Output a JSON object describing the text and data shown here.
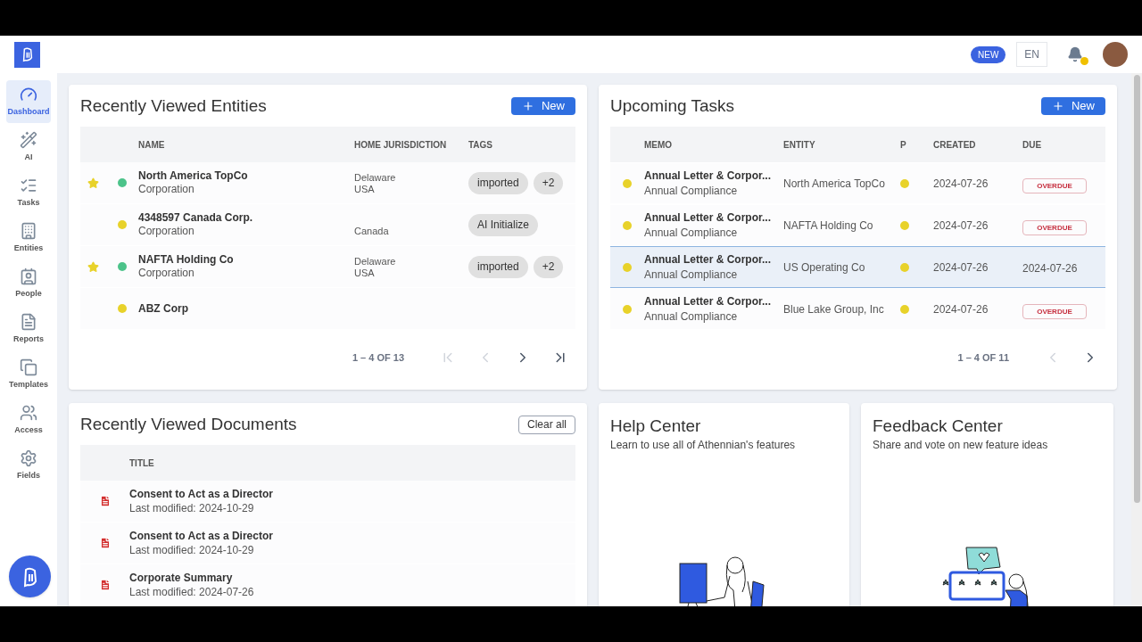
{
  "header": {
    "new_badge": "NEW",
    "language": "EN",
    "notification_dot": true
  },
  "sidebar": {
    "items": [
      {
        "label": "Dashboard",
        "kind": "dashboard",
        "selected": true
      },
      {
        "label": "AI",
        "kind": "ai",
        "selected": false
      },
      {
        "label": "Tasks",
        "kind": "tasks",
        "selected": false
      },
      {
        "label": "Entities",
        "kind": "entities",
        "selected": false
      },
      {
        "label": "People",
        "kind": "people",
        "selected": false
      },
      {
        "label": "Reports",
        "kind": "reports",
        "selected": false
      },
      {
        "label": "Templates",
        "kind": "templates",
        "selected": false
      },
      {
        "label": "Access",
        "kind": "access",
        "selected": false
      },
      {
        "label": "Fields",
        "kind": "fields",
        "selected": false
      }
    ]
  },
  "entities": {
    "title": "Recently Viewed Entities",
    "new_button": "New",
    "columns": [
      "NAME",
      "HOME JURISDICTION",
      "TAGS"
    ],
    "rows": [
      {
        "starred": true,
        "color": "#4cc38a",
        "name": "North America TopCo",
        "type": "Corporation",
        "jurisdiction": [
          "Delaware",
          "USA"
        ],
        "tags": [
          "imported",
          "+2"
        ]
      },
      {
        "starred": false,
        "color": "#e8d22a",
        "name": "4348597 Canada Corp.",
        "type": "Corporation",
        "jurisdiction": [
          "Canada"
        ],
        "tags": [
          "AI Initialize"
        ]
      },
      {
        "starred": true,
        "color": "#4cc38a",
        "name": "NAFTA Holding Co",
        "type": "Corporation",
        "jurisdiction": [
          "Delaware",
          "USA"
        ],
        "tags": [
          "imported",
          "+2"
        ]
      },
      {
        "starred": false,
        "color": "#e8d22a",
        "name": "ABZ Corp",
        "jurisdiction": [],
        "tags": []
      }
    ],
    "pagination": {
      "range": "1 – 4 OF 13",
      "buttons": [
        {
          "kind": "first",
          "disabled": true
        },
        {
          "kind": "prev",
          "disabled": true
        },
        {
          "kind": "next",
          "disabled": false
        },
        {
          "kind": "last",
          "disabled": false
        }
      ]
    }
  },
  "tasks": {
    "title": "Upcoming Tasks",
    "new_button": "New",
    "columns": [
      "MEMO",
      "ENTITY",
      "P",
      "CREATED",
      "DUE"
    ],
    "rows": [
      {
        "selected": false,
        "color": "#e8d22a",
        "memo": "Annual Letter & Corpor...",
        "category": "Annual Compliance",
        "entity": "North America TopCo",
        "priority": {
          "color": "#e8d22a"
        },
        "created": "2024-07-26",
        "due": {
          "kind": "badge",
          "text": "OVERDUE"
        }
      },
      {
        "selected": false,
        "color": "#e8d22a",
        "memo": "Annual Letter & Corpor...",
        "category": "Annual Compliance",
        "entity": "NAFTA Holding Co",
        "priority": {
          "color": "#e8d22a"
        },
        "created": "2024-07-26",
        "due": {
          "kind": "badge",
          "text": "OVERDUE"
        }
      },
      {
        "selected": true,
        "color": "#e8d22a",
        "memo": "Annual Letter & Corpor...",
        "category": "Annual Compliance",
        "entity": "US Operating Co",
        "priority": {
          "color": "#e8d22a"
        },
        "created": "2024-07-26",
        "due": {
          "kind": "date",
          "text": "2024-07-26"
        }
      },
      {
        "selected": false,
        "color": "#e8d22a",
        "memo": "Annual Letter & Corpor...",
        "category": "Annual Compliance",
        "entity": "Blue Lake Group, Inc",
        "priority": {
          "color": "#e8d22a"
        },
        "created": "2024-07-26",
        "due": {
          "kind": "badge",
          "text": "OVERDUE"
        }
      }
    ],
    "pagination": {
      "range": "1 – 4 OF 11",
      "buttons": [
        {
          "kind": "prev",
          "disabled": true
        },
        {
          "kind": "next",
          "disabled": false
        }
      ]
    }
  },
  "documents": {
    "title": "Recently Viewed Documents",
    "clear_button": "Clear all",
    "columns": [
      "TITLE"
    ],
    "rows": [
      {
        "title": "Consent to Act as a Director",
        "modified": "Last modified: 2024-10-29"
      },
      {
        "title": "Consent to Act as a Director",
        "modified": "Last modified: 2024-10-29"
      },
      {
        "title": "Corporate Summary",
        "modified": "Last modified: 2024-07-26"
      }
    ]
  },
  "help_center": {
    "title": "Help Center",
    "subtitle": "Learn to use all of Athennian's features"
  },
  "feedback_center": {
    "title": "Feedback Center",
    "subtitle": "Share and vote on new feature ideas"
  }
}
